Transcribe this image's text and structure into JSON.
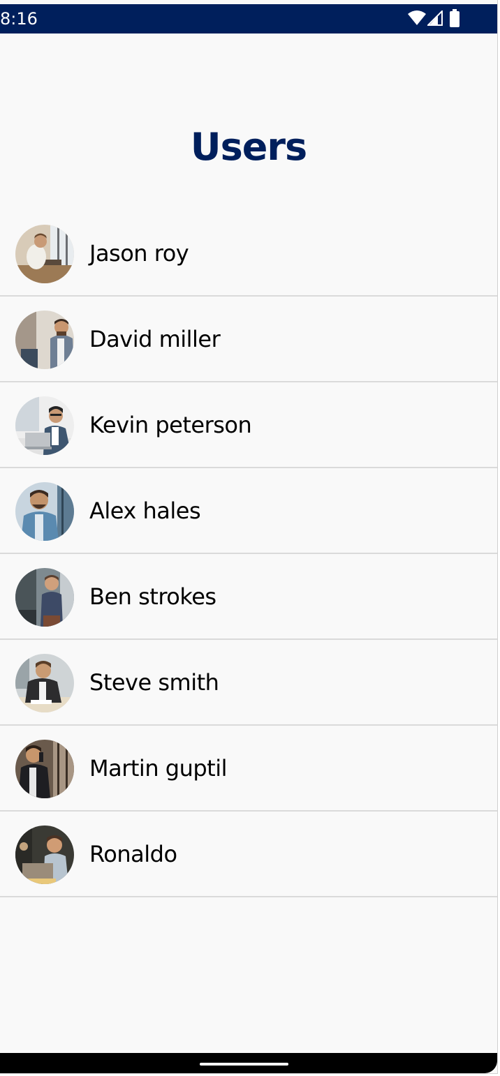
{
  "status_bar": {
    "time": "8:16",
    "background_color": "#001f5c",
    "icons": [
      "wifi-icon",
      "cellular-signal-icon",
      "battery-icon"
    ]
  },
  "header": {
    "title": "Users",
    "title_color": "#001f5c"
  },
  "users": [
    {
      "name": "Jason roy",
      "avatar": "avatar-photo-man-at-desk"
    },
    {
      "name": "David miller",
      "avatar": "avatar-photo-man-standing-office"
    },
    {
      "name": "Kevin peterson",
      "avatar": "avatar-photo-man-with-laptop"
    },
    {
      "name": "Alex hales",
      "avatar": "avatar-photo-man-smiling-blue-suit"
    },
    {
      "name": "Ben strokes",
      "avatar": "avatar-photo-man-standing-dark-office"
    },
    {
      "name": "Steve smith",
      "avatar": "avatar-photo-man-at-table"
    },
    {
      "name": "Martin guptil",
      "avatar": "avatar-photo-man-on-phone"
    },
    {
      "name": "Ronaldo",
      "avatar": "avatar-photo-man-with-laptop-dark"
    }
  ],
  "navigation_bar": {
    "icons": [
      "home-handle-icon"
    ]
  }
}
